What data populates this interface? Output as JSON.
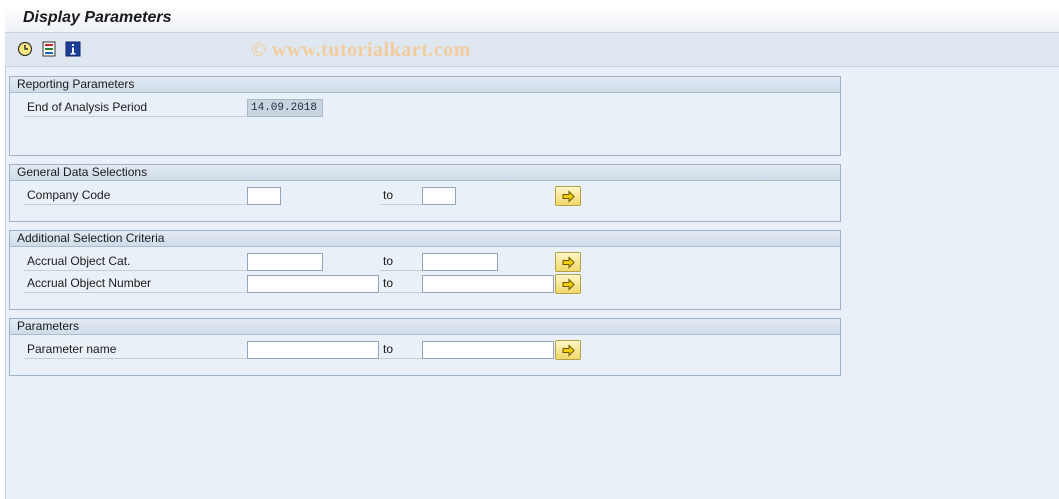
{
  "header": {
    "title": "Display Parameters"
  },
  "toolbar": {
    "icons": [
      "execute-icon",
      "selection-options-icon",
      "info-icon"
    ]
  },
  "watermark": "© www.tutorialkart.com",
  "groups": {
    "reporting": {
      "title": "Reporting Parameters",
      "end_of_period_label": "End of Analysis Period",
      "end_of_period_value": "14.09.2018"
    },
    "general": {
      "title": "General Data Selections",
      "company_code_label": "Company Code",
      "to_label": "to",
      "company_code_from": "",
      "company_code_to": ""
    },
    "additional": {
      "title": "Additional Selection Criteria",
      "accrual_cat_label": "Accrual Object Cat.",
      "accrual_num_label": "Accrual Object Number",
      "to_label": "to",
      "accrual_cat_from": "",
      "accrual_cat_to": "",
      "accrual_num_from": "",
      "accrual_num_to": ""
    },
    "parameters": {
      "title": "Parameters",
      "param_name_label": "Parameter name",
      "to_label": "to",
      "param_from": "",
      "param_to": ""
    }
  },
  "colors": {
    "accent_button": "#f0d767",
    "background": "#e9f0f7"
  }
}
